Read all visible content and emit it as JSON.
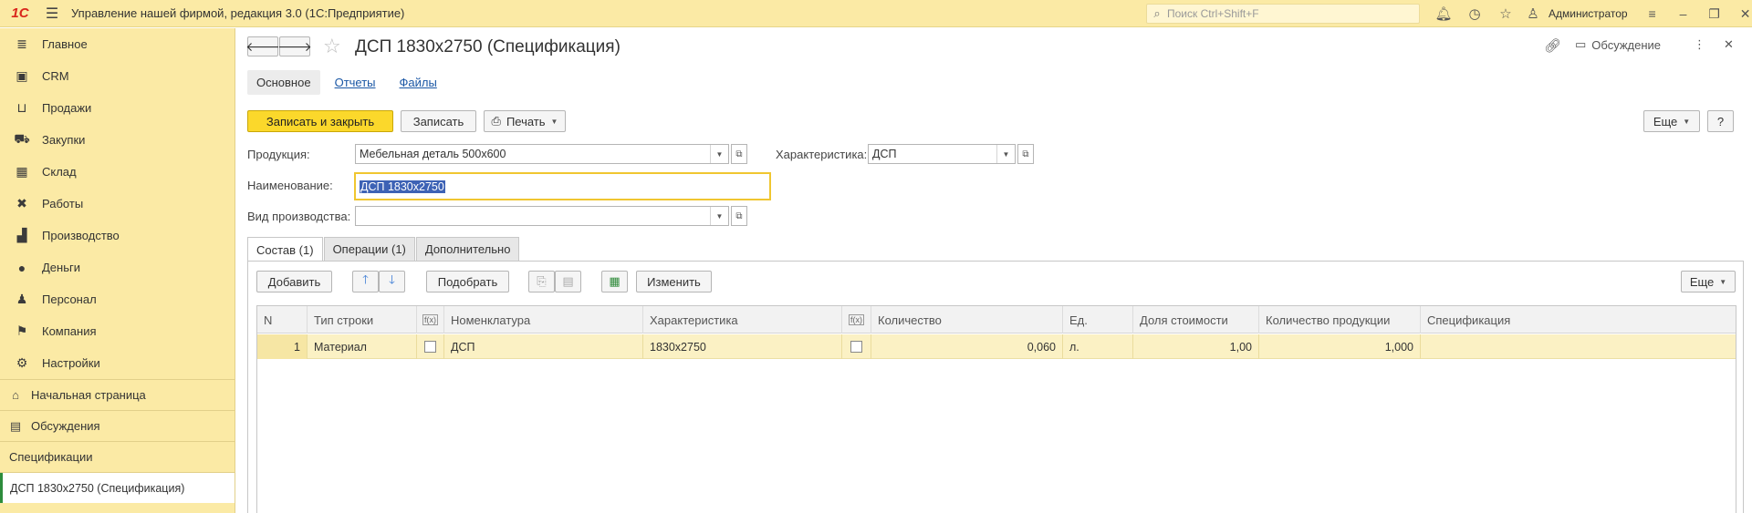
{
  "app": {
    "logo": "1С",
    "title": "Управление нашей фирмой, редакция 3.0  (1С:Предприятие)",
    "search_placeholder": "Поиск Ctrl+Shift+F",
    "user": "Администратор"
  },
  "sidebar": {
    "items": [
      {
        "label": "Главное",
        "icon": "menu-lines-icon"
      },
      {
        "label": "CRM",
        "icon": "contact-card-icon"
      },
      {
        "label": "Продажи",
        "icon": "basket-icon"
      },
      {
        "label": "Закупки",
        "icon": "cart-icon"
      },
      {
        "label": "Склад",
        "icon": "warehouse-grid-icon"
      },
      {
        "label": "Работы",
        "icon": "tools-icon"
      },
      {
        "label": "Производство",
        "icon": "factory-icon"
      },
      {
        "label": "Деньги",
        "icon": "money-icon"
      },
      {
        "label": "Персонал",
        "icon": "people-icon"
      },
      {
        "label": "Компания",
        "icon": "flag-icon"
      },
      {
        "label": "Настройки",
        "icon": "gear-icon"
      }
    ],
    "home": "Начальная страница",
    "discussions": "Обсуждения",
    "open_section": "Спецификации",
    "open_window": "ДСП 1830x2750 (Спецификация)"
  },
  "header": {
    "title": "ДСП 1830x2750 (Спецификация)",
    "discussion": "Обсуждение"
  },
  "form_tabs": [
    "Основное",
    "Отчеты",
    "Файлы"
  ],
  "toolbar": {
    "save_close": "Записать и закрыть",
    "save": "Записать",
    "print": "Печать",
    "more": "Еще",
    "help": "?"
  },
  "fields": {
    "product_label": "Продукция:",
    "product_value": "Мебельная деталь 500х600",
    "characteristic_label": "Характеристика:",
    "characteristic_value": "ДСП",
    "name_label": "Наименование:",
    "name_value": "ДСП 1830x2750",
    "prodtype_label": "Вид производства:",
    "prodtype_value": ""
  },
  "page_tabs": [
    "Состав (1)",
    "Операции (1)",
    "Дополнительно"
  ],
  "table_toolbar": {
    "add": "Добавить",
    "pick": "Подобрать",
    "change": "Изменить",
    "more": "Еще"
  },
  "table": {
    "columns": [
      "N",
      "Тип строки",
      "",
      "Номенклатура",
      "Характеристика",
      "",
      "Количество",
      "Ед.",
      "Доля стоимости",
      "Количество продукции",
      "Спецификация"
    ],
    "rows": [
      {
        "n": "1",
        "type": "Материал",
        "nomenclature": "ДСП",
        "characteristic": "1830x2750",
        "quantity": "0,060",
        "unit": "л.",
        "cost_share": "1,00",
        "product_qty": "1,000",
        "spec": ""
      }
    ]
  }
}
